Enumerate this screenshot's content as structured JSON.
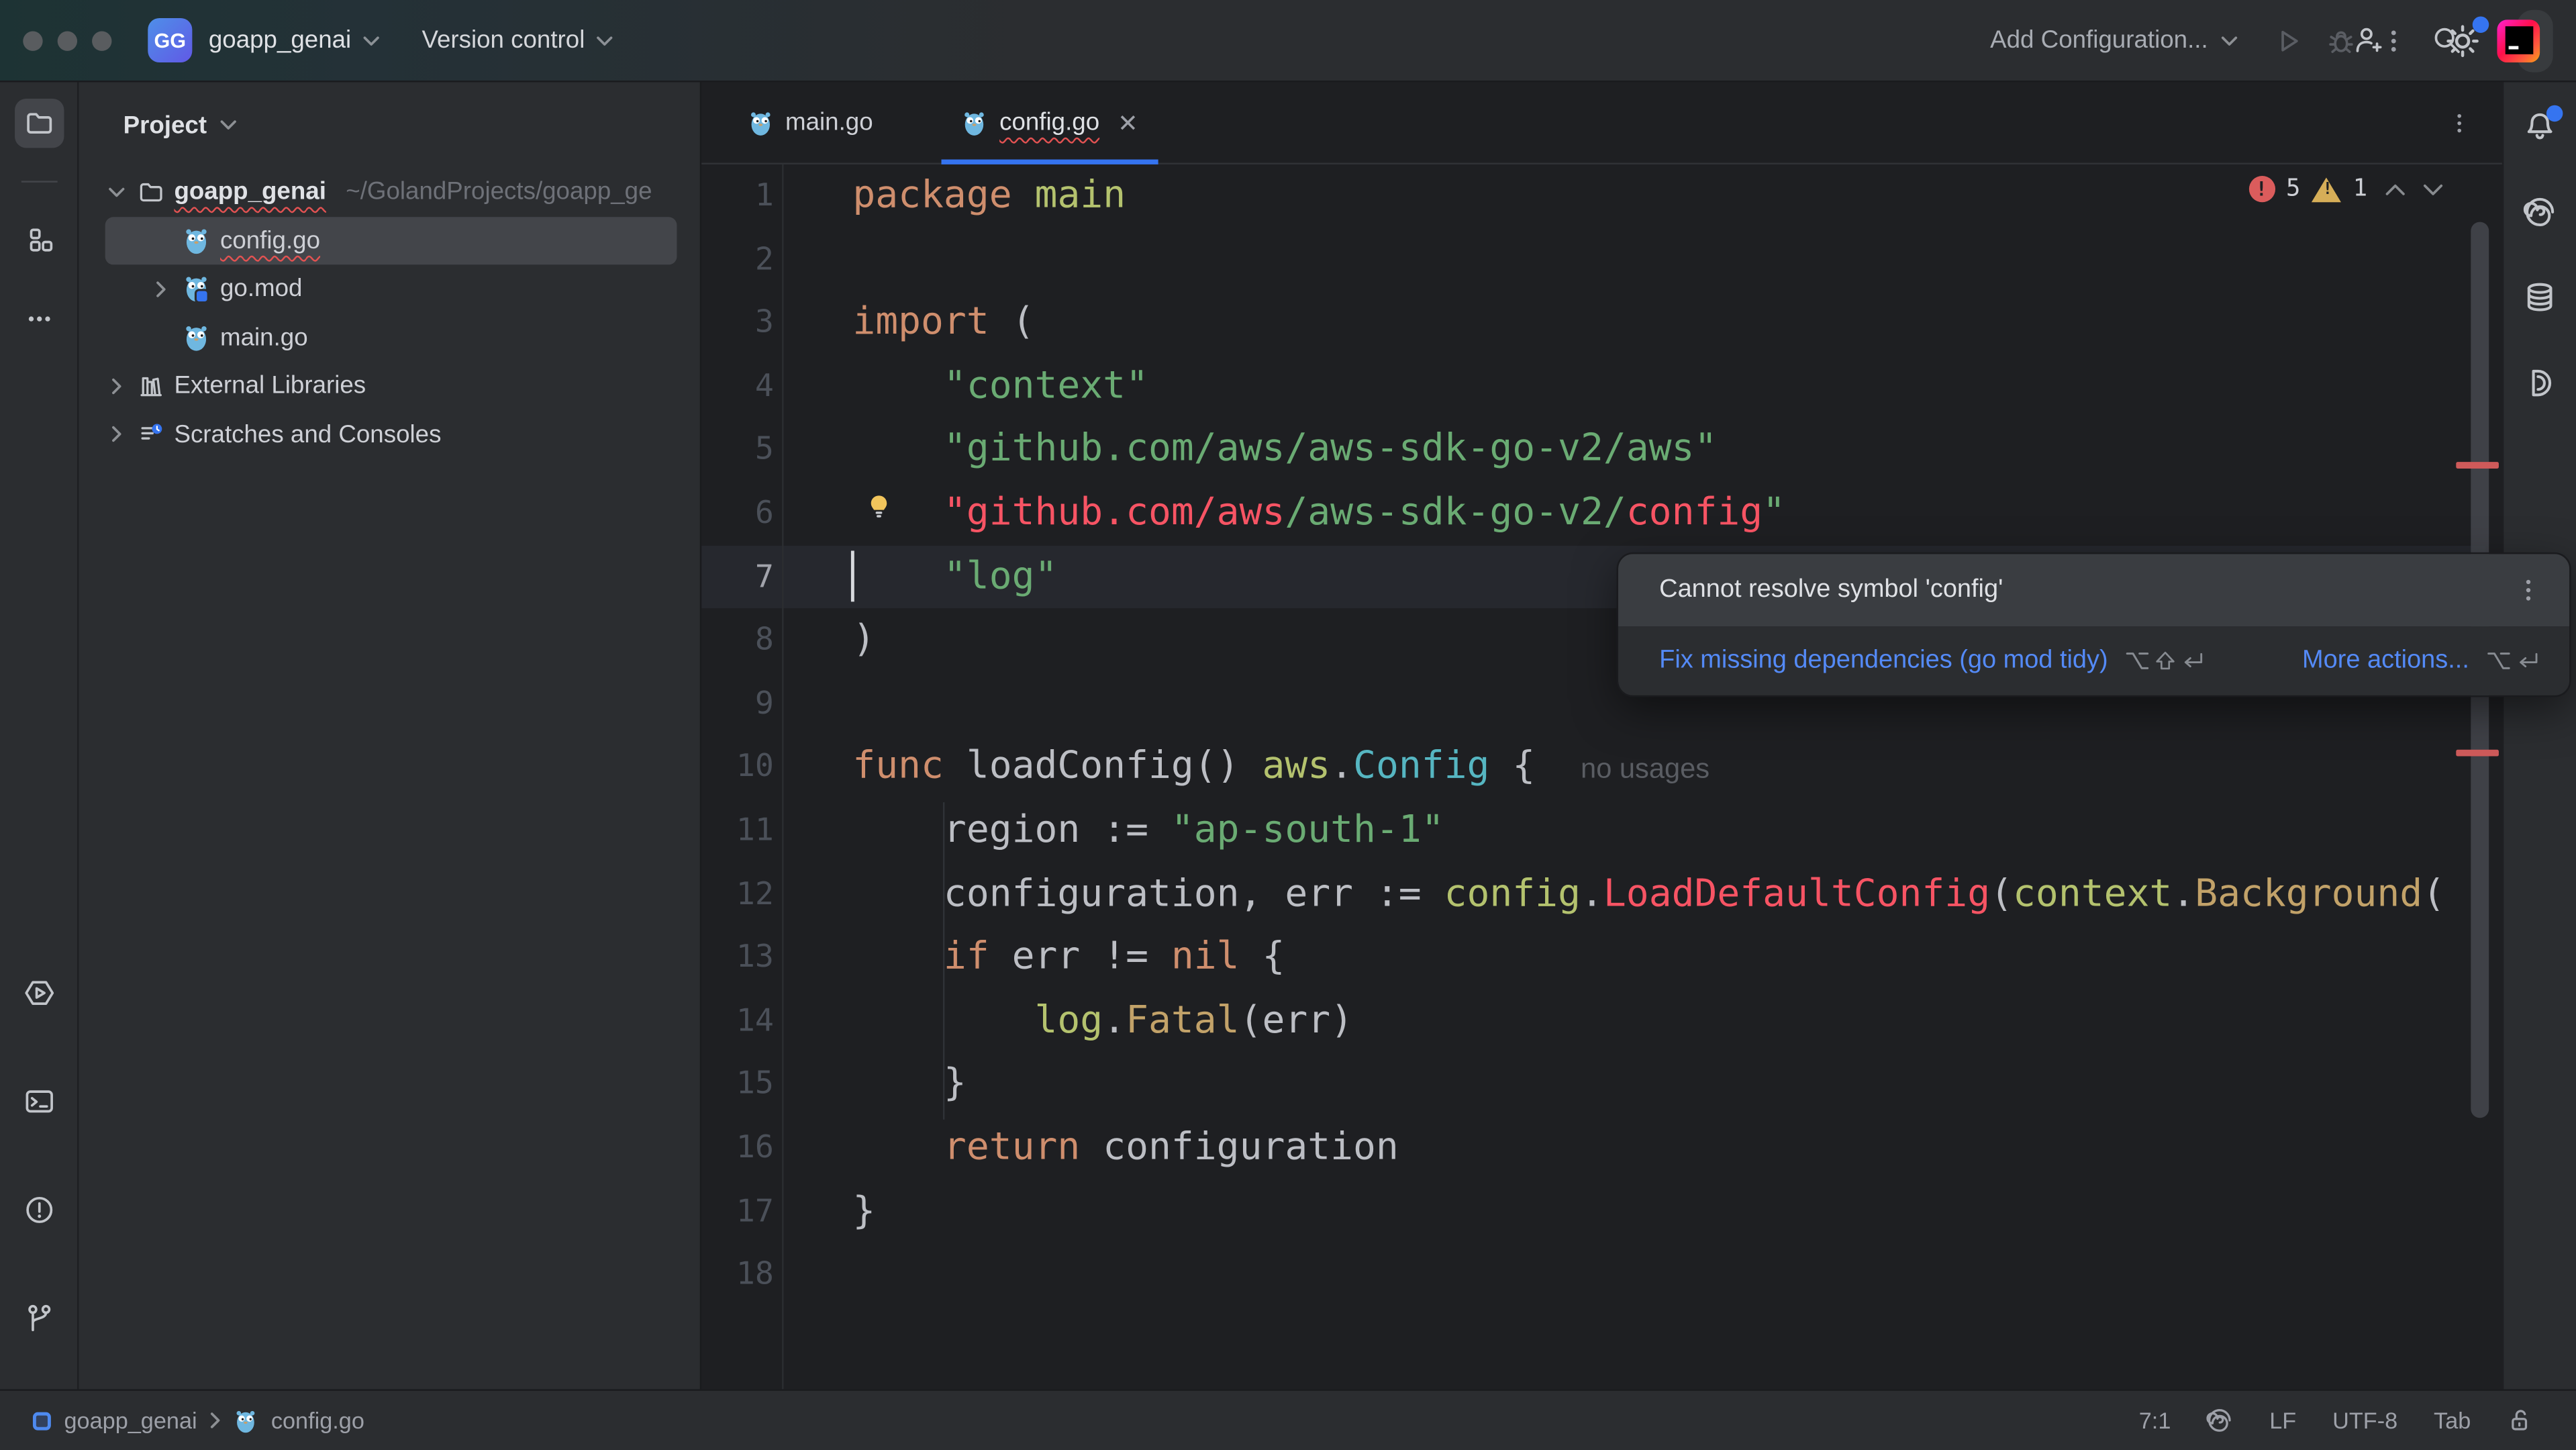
{
  "colors": {
    "accent": "#3574F0",
    "error": "#E35252",
    "errtext": "#F75464",
    "warning": "#D6AE58",
    "link": "#548AF7",
    "keyword": "#CF8E6D",
    "string": "#6AAB73",
    "package": "#B4C26E",
    "typec": "#56B6C2",
    "call": "#C2A269",
    "codetext": "#BCBEC4",
    "inlay": "#5A5D63",
    "gopher": "#6FB7E0"
  },
  "titlebar": {
    "project_initials": "GG",
    "project_name": "goapp_genai",
    "version_control": "Version control",
    "add_configuration": "Add Configuration...",
    "right_icons": [
      "run-icon",
      "debug-icon",
      "kebab-menu-icon",
      "add-user-icon",
      "search-icon",
      "settings-gear-icon",
      "jetbrains-logo-icon"
    ]
  },
  "left_toolstrip": {
    "icons": [
      "project-folder-icon",
      "structure-icon",
      "more-icon",
      "run-hexagon-icon",
      "terminal-icon",
      "problems-icon",
      "git-branch-icon"
    ]
  },
  "right_toolstrip": {
    "icons": [
      "notifications-bell-icon",
      "ai-assistant-icon",
      "database-icon",
      "documentation-icon"
    ]
  },
  "project_panel": {
    "title": "Project",
    "root": {
      "label": "goapp_genai",
      "path": "~/GolandProjects/goapp_ge"
    },
    "items": [
      {
        "label": "config.go",
        "selected": true
      },
      {
        "label": "go.mod"
      },
      {
        "label": "main.go"
      },
      {
        "label": "External Libraries"
      },
      {
        "label": "Scratches and Consoles"
      }
    ]
  },
  "editor": {
    "tabs": [
      {
        "label": "main.go"
      },
      {
        "label": "config.go"
      }
    ],
    "inspections": {
      "errors": "5",
      "warnings": "1"
    },
    "active_line": 7,
    "lines": [
      {
        "num": "1",
        "tokens": [
          {
            "c": "kw",
            "t": "package"
          },
          {
            "c": "pl",
            "t": " "
          },
          {
            "c": "pkg",
            "t": "main"
          }
        ]
      },
      {
        "num": "2",
        "tokens": []
      },
      {
        "num": "3",
        "tokens": [
          {
            "c": "kw",
            "t": "import"
          },
          {
            "c": "pl",
            "t": " ("
          }
        ]
      },
      {
        "num": "4",
        "tokens": [
          {
            "c": "pl",
            "t": "    "
          },
          {
            "c": "str",
            "t": "\"context\""
          }
        ]
      },
      {
        "num": "5",
        "tokens": [
          {
            "c": "pl",
            "t": "    "
          },
          {
            "c": "str",
            "t": "\"github.com/aws/aws-sdk-go-v2/aws\""
          }
        ]
      },
      {
        "num": "6",
        "tokens": [
          {
            "c": "pl",
            "t": "    "
          },
          {
            "c": "err",
            "t": "\"github.com/aws"
          },
          {
            "c": "str",
            "t": "/aws-sdk-go-v2/"
          },
          {
            "c": "err",
            "t": "config"
          },
          {
            "c": "str",
            "t": "\""
          }
        ]
      },
      {
        "num": "7",
        "tokens": [
          {
            "c": "pl",
            "t": "    "
          },
          {
            "c": "str",
            "t": "\"log\""
          }
        ]
      },
      {
        "num": "8",
        "tokens": [
          {
            "c": "pl",
            "t": ")"
          }
        ]
      },
      {
        "num": "9",
        "tokens": []
      },
      {
        "num": "10",
        "tokens": [
          {
            "c": "kw",
            "t": "func"
          },
          {
            "c": "pl",
            "t": " loadConfig() "
          },
          {
            "c": "pkg",
            "t": "aws"
          },
          {
            "c": "pl",
            "t": "."
          },
          {
            "c": "typ",
            "t": "Config"
          },
          {
            "c": "pl",
            "t": " {  "
          },
          {
            "c": "inlay",
            "t": "no usages"
          }
        ]
      },
      {
        "num": "11",
        "tokens": [
          {
            "c": "pl",
            "t": "    region := "
          },
          {
            "c": "str",
            "t": "\"ap-south-1\""
          }
        ]
      },
      {
        "num": "12",
        "tokens": [
          {
            "c": "pl",
            "t": "    configuration, err := "
          },
          {
            "c": "pkg",
            "t": "config"
          },
          {
            "c": "pl",
            "t": "."
          },
          {
            "c": "err",
            "t": "LoadDefaultConfig"
          },
          {
            "c": "pl",
            "t": "("
          },
          {
            "c": "pkg",
            "t": "context"
          },
          {
            "c": "pl",
            "t": "."
          },
          {
            "c": "call",
            "t": "Background"
          },
          {
            "c": "pl",
            "t": "("
          }
        ]
      },
      {
        "num": "13",
        "tokens": [
          {
            "c": "pl",
            "t": "    "
          },
          {
            "c": "kw",
            "t": "if"
          },
          {
            "c": "pl",
            "t": " err != "
          },
          {
            "c": "kw",
            "t": "nil"
          },
          {
            "c": "pl",
            "t": " {"
          }
        ]
      },
      {
        "num": "14",
        "tokens": [
          {
            "c": "pl",
            "t": "        "
          },
          {
            "c": "pkg",
            "t": "log"
          },
          {
            "c": "pl",
            "t": "."
          },
          {
            "c": "call",
            "t": "Fatal"
          },
          {
            "c": "pl",
            "t": "(err)"
          }
        ]
      },
      {
        "num": "15",
        "tokens": [
          {
            "c": "pl",
            "t": "    }"
          }
        ]
      },
      {
        "num": "16",
        "tokens": [
          {
            "c": "pl",
            "t": "    "
          },
          {
            "c": "kw",
            "t": "return"
          },
          {
            "c": "pl",
            "t": " configuration"
          }
        ]
      },
      {
        "num": "17",
        "tokens": [
          {
            "c": "pl",
            "t": "}"
          }
        ]
      },
      {
        "num": "18",
        "tokens": []
      }
    ]
  },
  "tooltip": {
    "message": "Cannot resolve symbol 'config'",
    "fix_label": "Fix missing dependencies (go mod tidy)",
    "fix_shortcut_icon": "opt-shift-enter",
    "more_label": "More actions...",
    "more_shortcut_icon": "opt-enter"
  },
  "status_bar": {
    "breadcrumb_project": "goapp_genai",
    "breadcrumb_file": "config.go",
    "caret_position": "7:1",
    "line_separator": "LF",
    "encoding": "UTF-8",
    "indent": "Tab",
    "icons": [
      "inspections-swirl-icon",
      "unlocked-icon"
    ]
  }
}
